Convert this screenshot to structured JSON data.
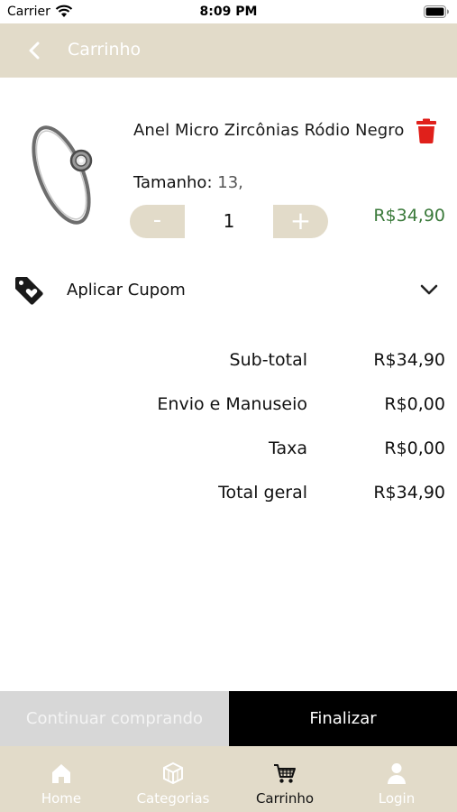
{
  "status_bar": {
    "carrier": "Carrier",
    "time": "8:09 PM"
  },
  "header": {
    "title": "Carrinho"
  },
  "cart_item": {
    "name": "Anel Micro Zircônias Ródio Negro",
    "size_label": "Tamanho:",
    "size_value": "13,",
    "quantity": "1",
    "minus_label": "-",
    "plus_label": "+",
    "price": "R$34,90"
  },
  "coupon": {
    "label": "Aplicar Cupom"
  },
  "summary": [
    {
      "label": "Sub-total",
      "value": "R$34,90"
    },
    {
      "label": "Envio e Manuseio",
      "value": "R$0,00"
    },
    {
      "label": "Taxa",
      "value": "R$0,00"
    },
    {
      "label": "Total geral",
      "value": "R$34,90"
    }
  ],
  "actions": {
    "continue_label": "Continuar comprando",
    "finish_label": "Finalizar"
  },
  "tabs": [
    {
      "label": "Home",
      "icon": "home-icon",
      "active": false
    },
    {
      "label": "Categorias",
      "icon": "categories-icon",
      "active": false
    },
    {
      "label": "Carrinho",
      "icon": "cart-icon",
      "active": true
    },
    {
      "label": "Login",
      "icon": "user-icon",
      "active": false
    }
  ],
  "colors": {
    "accent_beige": "#e2dbc9",
    "price_green": "#3b7a3b",
    "delete_red": "#e0201b",
    "finish_black": "#000000",
    "continue_gray": "#d7d7d7"
  }
}
